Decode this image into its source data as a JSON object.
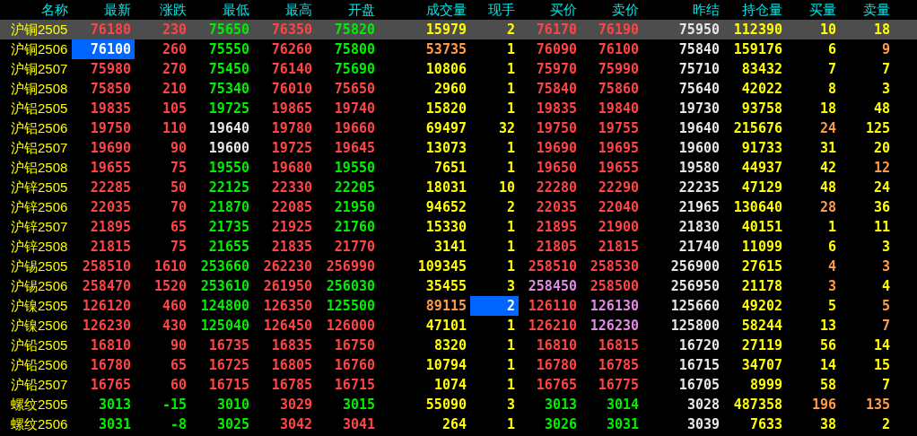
{
  "columns": [
    "名称",
    "最新",
    "涨跌",
    "最低",
    "最高",
    "开盘",
    "成交量",
    "现手",
    "买价",
    "卖价",
    "昨结",
    "持仓量",
    "买量",
    "卖量"
  ],
  "rows": [
    {
      "name": "沪铜2505",
      "selected": true,
      "cells": [
        {
          "text": "76180",
          "color": "#ff4444"
        },
        {
          "text": "230",
          "color": "#ff4444"
        },
        {
          "text": "75650",
          "color": "#00ee00"
        },
        {
          "text": "76350",
          "color": "#ff4444"
        },
        {
          "text": "75820",
          "color": "#00ee00"
        },
        {
          "text": "15979",
          "color": "#ffff00"
        },
        {
          "text": "2",
          "color": "#ffff00"
        },
        {
          "text": "76170",
          "color": "#ff4444"
        },
        {
          "text": "76190",
          "color": "#ff4444"
        },
        {
          "text": "75950",
          "color": "#e6e6e6"
        },
        {
          "text": "112390",
          "color": "#ffff00"
        },
        {
          "text": "10",
          "color": "#ffff00"
        },
        {
          "text": "18",
          "color": "#ffff00"
        }
      ]
    },
    {
      "name": "沪铜2506",
      "selected": false,
      "cells": [
        {
          "text": "76100",
          "color": "#ffffff",
          "flash": true
        },
        {
          "text": "260",
          "color": "#ff4444"
        },
        {
          "text": "75550",
          "color": "#00ee00"
        },
        {
          "text": "76260",
          "color": "#ff4444"
        },
        {
          "text": "75800",
          "color": "#00ee00"
        },
        {
          "text": "53735",
          "color": "#ff9a4a"
        },
        {
          "text": "1",
          "color": "#ffff00"
        },
        {
          "text": "76090",
          "color": "#ff4444"
        },
        {
          "text": "76100",
          "color": "#ff4444"
        },
        {
          "text": "75840",
          "color": "#e6e6e6"
        },
        {
          "text": "159176",
          "color": "#ffff00"
        },
        {
          "text": "6",
          "color": "#ffff00"
        },
        {
          "text": "9",
          "color": "#ff9a4a"
        }
      ]
    },
    {
      "name": "沪铜2507",
      "selected": false,
      "cells": [
        {
          "text": "75980",
          "color": "#ff4444"
        },
        {
          "text": "270",
          "color": "#ff4444"
        },
        {
          "text": "75450",
          "color": "#00ee00"
        },
        {
          "text": "76140",
          "color": "#ff4444"
        },
        {
          "text": "75690",
          "color": "#00ee00"
        },
        {
          "text": "10806",
          "color": "#ffff00"
        },
        {
          "text": "1",
          "color": "#ffff00"
        },
        {
          "text": "75970",
          "color": "#ff4444"
        },
        {
          "text": "75990",
          "color": "#ff4444"
        },
        {
          "text": "75710",
          "color": "#e6e6e6"
        },
        {
          "text": "83432",
          "color": "#ffff00"
        },
        {
          "text": "7",
          "color": "#ffff00"
        },
        {
          "text": "7",
          "color": "#ffff00"
        }
      ]
    },
    {
      "name": "沪铜2508",
      "selected": false,
      "cells": [
        {
          "text": "75850",
          "color": "#ff4444"
        },
        {
          "text": "210",
          "color": "#ff4444"
        },
        {
          "text": "75340",
          "color": "#00ee00"
        },
        {
          "text": "76010",
          "color": "#ff4444"
        },
        {
          "text": "75650",
          "color": "#ff4444"
        },
        {
          "text": "2960",
          "color": "#ffff00"
        },
        {
          "text": "1",
          "color": "#ffff00"
        },
        {
          "text": "75840",
          "color": "#ff4444"
        },
        {
          "text": "75860",
          "color": "#ff4444"
        },
        {
          "text": "75640",
          "color": "#e6e6e6"
        },
        {
          "text": "42022",
          "color": "#ffff00"
        },
        {
          "text": "8",
          "color": "#ffff00"
        },
        {
          "text": "3",
          "color": "#ffff00"
        }
      ]
    },
    {
      "name": "沪铝2505",
      "selected": false,
      "cells": [
        {
          "text": "19835",
          "color": "#ff4444"
        },
        {
          "text": "105",
          "color": "#ff4444"
        },
        {
          "text": "19725",
          "color": "#00ee00"
        },
        {
          "text": "19865",
          "color": "#ff4444"
        },
        {
          "text": "19740",
          "color": "#ff4444"
        },
        {
          "text": "15820",
          "color": "#ffff00"
        },
        {
          "text": "1",
          "color": "#ffff00"
        },
        {
          "text": "19835",
          "color": "#ff4444"
        },
        {
          "text": "19840",
          "color": "#ff4444"
        },
        {
          "text": "19730",
          "color": "#e6e6e6"
        },
        {
          "text": "93758",
          "color": "#ffff00"
        },
        {
          "text": "18",
          "color": "#ffff00"
        },
        {
          "text": "48",
          "color": "#ffff00"
        }
      ]
    },
    {
      "name": "沪铝2506",
      "selected": false,
      "cells": [
        {
          "text": "19750",
          "color": "#ff4444"
        },
        {
          "text": "110",
          "color": "#ff4444"
        },
        {
          "text": "19640",
          "color": "#e6e6e6"
        },
        {
          "text": "19780",
          "color": "#ff4444"
        },
        {
          "text": "19660",
          "color": "#ff4444"
        },
        {
          "text": "69497",
          "color": "#ffff00"
        },
        {
          "text": "32",
          "color": "#ffff00"
        },
        {
          "text": "19750",
          "color": "#ff4444"
        },
        {
          "text": "19755",
          "color": "#ff4444"
        },
        {
          "text": "19640",
          "color": "#e6e6e6"
        },
        {
          "text": "215676",
          "color": "#ffff00"
        },
        {
          "text": "24",
          "color": "#ff9a4a"
        },
        {
          "text": "125",
          "color": "#ffff00"
        }
      ]
    },
    {
      "name": "沪铝2507",
      "selected": false,
      "cells": [
        {
          "text": "19690",
          "color": "#ff4444"
        },
        {
          "text": "90",
          "color": "#ff4444"
        },
        {
          "text": "19600",
          "color": "#e6e6e6"
        },
        {
          "text": "19725",
          "color": "#ff4444"
        },
        {
          "text": "19645",
          "color": "#ff4444"
        },
        {
          "text": "13073",
          "color": "#ffff00"
        },
        {
          "text": "1",
          "color": "#ffff00"
        },
        {
          "text": "19690",
          "color": "#ff4444"
        },
        {
          "text": "19695",
          "color": "#ff4444"
        },
        {
          "text": "19600",
          "color": "#e6e6e6"
        },
        {
          "text": "91733",
          "color": "#ffff00"
        },
        {
          "text": "31",
          "color": "#ffff00"
        },
        {
          "text": "20",
          "color": "#ffff00"
        }
      ]
    },
    {
      "name": "沪铝2508",
      "selected": false,
      "cells": [
        {
          "text": "19655",
          "color": "#ff4444"
        },
        {
          "text": "75",
          "color": "#ff4444"
        },
        {
          "text": "19550",
          "color": "#00ee00"
        },
        {
          "text": "19680",
          "color": "#ff4444"
        },
        {
          "text": "19550",
          "color": "#00ee00"
        },
        {
          "text": "7651",
          "color": "#ffff00"
        },
        {
          "text": "1",
          "color": "#ffff00"
        },
        {
          "text": "19650",
          "color": "#ff4444"
        },
        {
          "text": "19655",
          "color": "#ff4444"
        },
        {
          "text": "19580",
          "color": "#e6e6e6"
        },
        {
          "text": "44937",
          "color": "#ffff00"
        },
        {
          "text": "42",
          "color": "#ffff00"
        },
        {
          "text": "12",
          "color": "#ff9a4a"
        }
      ]
    },
    {
      "name": "沪锌2505",
      "selected": false,
      "cells": [
        {
          "text": "22285",
          "color": "#ff4444"
        },
        {
          "text": "50",
          "color": "#ff4444"
        },
        {
          "text": "22125",
          "color": "#00ee00"
        },
        {
          "text": "22330",
          "color": "#ff4444"
        },
        {
          "text": "22205",
          "color": "#00ee00"
        },
        {
          "text": "18031",
          "color": "#ffff00"
        },
        {
          "text": "10",
          "color": "#ffff00"
        },
        {
          "text": "22280",
          "color": "#ff4444"
        },
        {
          "text": "22290",
          "color": "#ff4444"
        },
        {
          "text": "22235",
          "color": "#e6e6e6"
        },
        {
          "text": "47129",
          "color": "#ffff00"
        },
        {
          "text": "48",
          "color": "#ffff00"
        },
        {
          "text": "24",
          "color": "#ffff00"
        }
      ]
    },
    {
      "name": "沪锌2506",
      "selected": false,
      "cells": [
        {
          "text": "22035",
          "color": "#ff4444"
        },
        {
          "text": "70",
          "color": "#ff4444"
        },
        {
          "text": "21870",
          "color": "#00ee00"
        },
        {
          "text": "22085",
          "color": "#ff4444"
        },
        {
          "text": "21950",
          "color": "#00ee00"
        },
        {
          "text": "94652",
          "color": "#ffff00"
        },
        {
          "text": "2",
          "color": "#ffff00"
        },
        {
          "text": "22035",
          "color": "#ff4444"
        },
        {
          "text": "22040",
          "color": "#ff4444"
        },
        {
          "text": "21965",
          "color": "#e6e6e6"
        },
        {
          "text": "130640",
          "color": "#ffff00"
        },
        {
          "text": "28",
          "color": "#ff9a4a"
        },
        {
          "text": "36",
          "color": "#ffff00"
        }
      ]
    },
    {
      "name": "沪锌2507",
      "selected": false,
      "cells": [
        {
          "text": "21895",
          "color": "#ff4444"
        },
        {
          "text": "65",
          "color": "#ff4444"
        },
        {
          "text": "21735",
          "color": "#00ee00"
        },
        {
          "text": "21925",
          "color": "#ff4444"
        },
        {
          "text": "21760",
          "color": "#00ee00"
        },
        {
          "text": "15330",
          "color": "#ffff00"
        },
        {
          "text": "1",
          "color": "#ffff00"
        },
        {
          "text": "21895",
          "color": "#ff4444"
        },
        {
          "text": "21900",
          "color": "#ff4444"
        },
        {
          "text": "21830",
          "color": "#e6e6e6"
        },
        {
          "text": "40151",
          "color": "#ffff00"
        },
        {
          "text": "1",
          "color": "#ffff00"
        },
        {
          "text": "11",
          "color": "#ffff00"
        }
      ]
    },
    {
      "name": "沪锌2508",
      "selected": false,
      "cells": [
        {
          "text": "21815",
          "color": "#ff4444"
        },
        {
          "text": "75",
          "color": "#ff4444"
        },
        {
          "text": "21655",
          "color": "#00ee00"
        },
        {
          "text": "21835",
          "color": "#ff4444"
        },
        {
          "text": "21770",
          "color": "#ff4444"
        },
        {
          "text": "3141",
          "color": "#ffff00"
        },
        {
          "text": "1",
          "color": "#ffff00"
        },
        {
          "text": "21805",
          "color": "#ff4444"
        },
        {
          "text": "21815",
          "color": "#ff4444"
        },
        {
          "text": "21740",
          "color": "#e6e6e6"
        },
        {
          "text": "11099",
          "color": "#ffff00"
        },
        {
          "text": "6",
          "color": "#ffff00"
        },
        {
          "text": "3",
          "color": "#ffff00"
        }
      ]
    },
    {
      "name": "沪锡2505",
      "selected": false,
      "cells": [
        {
          "text": "258510",
          "color": "#ff4444"
        },
        {
          "text": "1610",
          "color": "#ff4444"
        },
        {
          "text": "253660",
          "color": "#00ee00"
        },
        {
          "text": "262230",
          "color": "#ff4444"
        },
        {
          "text": "256990",
          "color": "#ff4444"
        },
        {
          "text": "109345",
          "color": "#ffff00"
        },
        {
          "text": "1",
          "color": "#ffff00"
        },
        {
          "text": "258510",
          "color": "#ff4444"
        },
        {
          "text": "258530",
          "color": "#ff4444"
        },
        {
          "text": "256900",
          "color": "#e6e6e6"
        },
        {
          "text": "27615",
          "color": "#ffff00"
        },
        {
          "text": "4",
          "color": "#ff9a4a"
        },
        {
          "text": "3",
          "color": "#ff9a4a"
        }
      ]
    },
    {
      "name": "沪锡2506",
      "selected": false,
      "cells": [
        {
          "text": "258470",
          "color": "#ff4444"
        },
        {
          "text": "1520",
          "color": "#ff4444"
        },
        {
          "text": "253610",
          "color": "#00ee00"
        },
        {
          "text": "261950",
          "color": "#ff4444"
        },
        {
          "text": "256030",
          "color": "#00ee00"
        },
        {
          "text": "35455",
          "color": "#ffff00"
        },
        {
          "text": "3",
          "color": "#ffff00"
        },
        {
          "text": "258450",
          "color": "#e08ae0"
        },
        {
          "text": "258500",
          "color": "#ff4444"
        },
        {
          "text": "256950",
          "color": "#e6e6e6"
        },
        {
          "text": "21178",
          "color": "#ffff00"
        },
        {
          "text": "3",
          "color": "#ff9a4a"
        },
        {
          "text": "4",
          "color": "#ffff00"
        }
      ]
    },
    {
      "name": "沪镍2505",
      "selected": false,
      "cells": [
        {
          "text": "126120",
          "color": "#ff4444"
        },
        {
          "text": "460",
          "color": "#ff4444"
        },
        {
          "text": "124800",
          "color": "#00ee00"
        },
        {
          "text": "126350",
          "color": "#ff4444"
        },
        {
          "text": "125500",
          "color": "#00ee00"
        },
        {
          "text": "89115",
          "color": "#ff9a4a"
        },
        {
          "text": "2",
          "color": "#ffffff",
          "flash": true
        },
        {
          "text": "126110",
          "color": "#ff4444"
        },
        {
          "text": "126130",
          "color": "#e08ae0"
        },
        {
          "text": "125660",
          "color": "#e6e6e6"
        },
        {
          "text": "49202",
          "color": "#ffff00"
        },
        {
          "text": "5",
          "color": "#ffff00"
        },
        {
          "text": "5",
          "color": "#ff9a4a"
        }
      ]
    },
    {
      "name": "沪镍2506",
      "selected": false,
      "cells": [
        {
          "text": "126230",
          "color": "#ff4444"
        },
        {
          "text": "430",
          "color": "#ff4444"
        },
        {
          "text": "125040",
          "color": "#00ee00"
        },
        {
          "text": "126450",
          "color": "#ff4444"
        },
        {
          "text": "126000",
          "color": "#ff4444"
        },
        {
          "text": "47101",
          "color": "#ffff00"
        },
        {
          "text": "1",
          "color": "#ffff00"
        },
        {
          "text": "126210",
          "color": "#ff4444"
        },
        {
          "text": "126230",
          "color": "#e08ae0"
        },
        {
          "text": "125800",
          "color": "#e6e6e6"
        },
        {
          "text": "58244",
          "color": "#ffff00"
        },
        {
          "text": "13",
          "color": "#ffff00"
        },
        {
          "text": "7",
          "color": "#ff9a4a"
        }
      ]
    },
    {
      "name": "沪铅2505",
      "selected": false,
      "cells": [
        {
          "text": "16810",
          "color": "#ff4444"
        },
        {
          "text": "90",
          "color": "#ff4444"
        },
        {
          "text": "16735",
          "color": "#ff4444"
        },
        {
          "text": "16835",
          "color": "#ff4444"
        },
        {
          "text": "16750",
          "color": "#ff4444"
        },
        {
          "text": "8320",
          "color": "#ffff00"
        },
        {
          "text": "1",
          "color": "#ffff00"
        },
        {
          "text": "16810",
          "color": "#ff4444"
        },
        {
          "text": "16815",
          "color": "#ff4444"
        },
        {
          "text": "16720",
          "color": "#e6e6e6"
        },
        {
          "text": "27119",
          "color": "#ffff00"
        },
        {
          "text": "56",
          "color": "#ffff00"
        },
        {
          "text": "14",
          "color": "#ffff00"
        }
      ]
    },
    {
      "name": "沪铅2506",
      "selected": false,
      "cells": [
        {
          "text": "16780",
          "color": "#ff4444"
        },
        {
          "text": "65",
          "color": "#ff4444"
        },
        {
          "text": "16725",
          "color": "#ff4444"
        },
        {
          "text": "16805",
          "color": "#ff4444"
        },
        {
          "text": "16760",
          "color": "#ff4444"
        },
        {
          "text": "10794",
          "color": "#ffff00"
        },
        {
          "text": "1",
          "color": "#ffff00"
        },
        {
          "text": "16780",
          "color": "#ff4444"
        },
        {
          "text": "16785",
          "color": "#ff4444"
        },
        {
          "text": "16715",
          "color": "#e6e6e6"
        },
        {
          "text": "34707",
          "color": "#ffff00"
        },
        {
          "text": "14",
          "color": "#ffff00"
        },
        {
          "text": "15",
          "color": "#ffff00"
        }
      ]
    },
    {
      "name": "沪铅2507",
      "selected": false,
      "cells": [
        {
          "text": "16765",
          "color": "#ff4444"
        },
        {
          "text": "60",
          "color": "#ff4444"
        },
        {
          "text": "16715",
          "color": "#ff4444"
        },
        {
          "text": "16785",
          "color": "#ff4444"
        },
        {
          "text": "16715",
          "color": "#ff4444"
        },
        {
          "text": "1074",
          "color": "#ffff00"
        },
        {
          "text": "1",
          "color": "#ffff00"
        },
        {
          "text": "16765",
          "color": "#ff4444"
        },
        {
          "text": "16775",
          "color": "#ff4444"
        },
        {
          "text": "16705",
          "color": "#e6e6e6"
        },
        {
          "text": "8999",
          "color": "#ffff00"
        },
        {
          "text": "58",
          "color": "#ffff00"
        },
        {
          "text": "7",
          "color": "#ffff00"
        }
      ]
    },
    {
      "name": "螺纹2505",
      "selected": false,
      "cells": [
        {
          "text": "3013",
          "color": "#00ee00"
        },
        {
          "text": "-15",
          "color": "#00ee00"
        },
        {
          "text": "3010",
          "color": "#00ee00"
        },
        {
          "text": "3029",
          "color": "#ff4444"
        },
        {
          "text": "3015",
          "color": "#00ee00"
        },
        {
          "text": "55090",
          "color": "#ffff00"
        },
        {
          "text": "3",
          "color": "#ffff00"
        },
        {
          "text": "3013",
          "color": "#00ee00"
        },
        {
          "text": "3014",
          "color": "#00ee00"
        },
        {
          "text": "3028",
          "color": "#e6e6e6"
        },
        {
          "text": "487358",
          "color": "#ffff00"
        },
        {
          "text": "196",
          "color": "#ff9a4a"
        },
        {
          "text": "135",
          "color": "#ff9a4a"
        }
      ]
    },
    {
      "name": "螺纹2506",
      "selected": false,
      "cells": [
        {
          "text": "3031",
          "color": "#00ee00"
        },
        {
          "text": "-8",
          "color": "#00ee00"
        },
        {
          "text": "3025",
          "color": "#00ee00"
        },
        {
          "text": "3042",
          "color": "#ff4444"
        },
        {
          "text": "3041",
          "color": "#ff4444"
        },
        {
          "text": "264",
          "color": "#ffff00"
        },
        {
          "text": "1",
          "color": "#ffff00"
        },
        {
          "text": "3026",
          "color": "#00ee00"
        },
        {
          "text": "3031",
          "color": "#00ee00"
        },
        {
          "text": "3039",
          "color": "#e6e6e6"
        },
        {
          "text": "7633",
          "color": "#ffff00"
        },
        {
          "text": "38",
          "color": "#ffff00"
        },
        {
          "text": "2",
          "color": "#ffff00"
        }
      ]
    }
  ]
}
